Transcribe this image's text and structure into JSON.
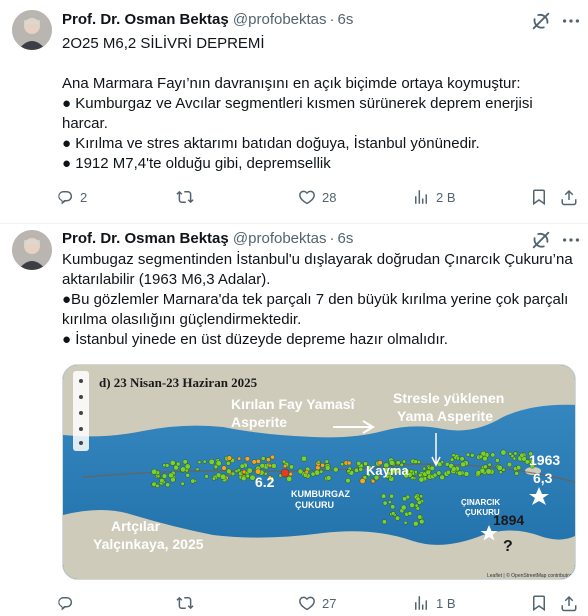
{
  "tweets": [
    {
      "author": {
        "name": "Prof. Dr. Osman Bektaş",
        "handle": "@profobektas",
        "time": "6s"
      },
      "text": "2O25 M6,2 SİLİVRİ DEPREMİ\n\nAna Marmara Fayı’nın davranışını en açık biçimde ortaya koymuştur:\n● Kumburgaz ve Avcılar segmentleri kısmen sürünerek deprem enerjisi harcar.\n● Kırılma ve stres aktarımı batıdan doğuya, İstanbul yönünedir.\n● 1912 M7,4'te olduğu gibi, depremsellik",
      "stats": {
        "replies": "2",
        "reposts": "",
        "likes": "28",
        "views": "2 B"
      }
    },
    {
      "author": {
        "name": "Prof. Dr. Osman Bektaş",
        "handle": "@profobektas",
        "time": "6s"
      },
      "text": "Kumbugaz segmentinden İstanbul'u dışlayarak doğrudan Çınarcık Çukuru’na aktarılabilir (1963 M6,3 Adalar).\n●Bu gözlemler Marnara'da tek parçalı 7 den büyük kırılma yerine çok parçalı kırılma olasılığını güçlendirmektedir.\n● İstanbul yinede en üst düzeyde depreme hazır olmalıdır.",
      "stats": {
        "replies": "",
        "reposts": "",
        "likes": "27",
        "views": "1 B"
      },
      "media": {
        "panel_title": "d) 23 Nisan-23 Haziran 2025",
        "label_asperite": "Kırılan Fay Yamasî\nAsperite",
        "label_stress": "Stresle yüklenen\nYama Asperite",
        "label_kayma": "Kayma",
        "label_62": "6.2",
        "label_kumburgaz": "KUMBURGAZ\nÇUKURU",
        "label_artcilar": "Artçılar\nYalçınkaya, 2025",
        "label_cinarcik": "ÇINARCIK\nÇUKURU",
        "label_1963": "1963\n6,3",
        "label_1894": "1894",
        "label_question": "?",
        "attribution": "Leaflet | © OpenStreetMap contributors",
        "colors": {
          "sea": "#2f7fb6",
          "land": "#c9c6b6",
          "quake_green": "#7bd12e",
          "quake_orange": "#f5a623",
          "quake_red": "#e53b1f"
        }
      }
    }
  ]
}
